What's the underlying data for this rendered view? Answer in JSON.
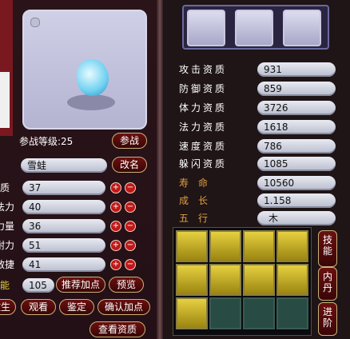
{
  "pet": {
    "level_label": "参战等级:25",
    "name": "雪蛙",
    "battle_label": "参战",
    "rename_label": "改名"
  },
  "attributes": [
    {
      "label": "体质",
      "visible_label": "体质",
      "value": "37"
    },
    {
      "label": "法力",
      "visible_label": "法力",
      "value": "40"
    },
    {
      "label": "力量",
      "visible_label": "力量",
      "value": "36"
    },
    {
      "label": "耐力",
      "visible_label": "耐力",
      "value": "51"
    },
    {
      "label": "敏捷",
      "visible_label": "敏捷",
      "value": "41"
    }
  ],
  "potential": {
    "label": "潜能",
    "value": "105"
  },
  "buttons": {
    "recommend": "推荐加点",
    "preview": "预览",
    "release": "放生",
    "watch": "观看",
    "identify": "鉴定",
    "confirm": "确认加点",
    "view_aptitude": "查看资质"
  },
  "aptitudes": [
    {
      "label": "攻击资质",
      "value": "931"
    },
    {
      "label": "防御资质",
      "value": "859"
    },
    {
      "label": "体力资质",
      "value": "3726"
    },
    {
      "label": "法力资质",
      "value": "1618"
    },
    {
      "label": "速度资质",
      "value": "786"
    },
    {
      "label": "躲闪资质",
      "value": "1085"
    }
  ],
  "extra": [
    {
      "label": "寿　命",
      "value": "10560"
    },
    {
      "label": "成　长",
      "value": "1.158"
    },
    {
      "label": "五　行",
      "value": "木"
    }
  ],
  "side_tabs": [
    "技能",
    "内丹",
    "进阶"
  ],
  "skills": [
    "hourglass-icon",
    "meteor-icon",
    "gear-sun-icon",
    "flame-icon",
    "eye-icon",
    "bird-icon",
    "owl-icon",
    "figure-icon",
    "claw-icon",
    "empty-slot-icon",
    "empty-slot-icon",
    "empty-slot-icon"
  ],
  "colors": {
    "gold": "#e6d040",
    "orange": "#e0a040"
  }
}
